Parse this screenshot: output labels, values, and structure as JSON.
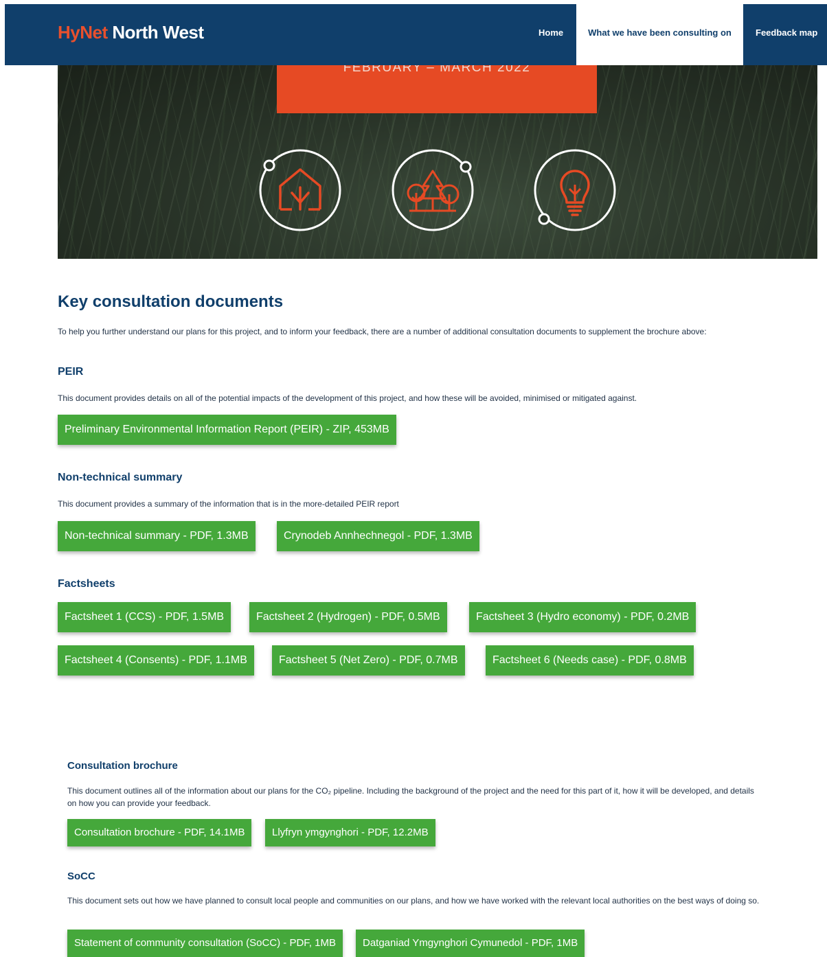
{
  "header": {
    "logo_hy": "HyNet",
    "logo_rest": " North West",
    "nav": {
      "home": "Home",
      "consulting": "What we have been consulting on",
      "feedback": "Feedback map"
    }
  },
  "hero": {
    "banner_text": "FEBRUARY – MARCH 2022",
    "icons": [
      "house-arrow-icon",
      "trees-icon",
      "lightbulb-icon"
    ]
  },
  "main": {
    "title": "Key consultation documents",
    "intro": "To help you further understand our plans for this project, and to inform your feedback, there are a number of additional consultation documents to supplement the brochure above:",
    "peir": {
      "heading": "PEIR",
      "desc": "This document provides details on all of the potential impacts of the development of this project, and how these will be avoided, minimised or mitigated against.",
      "buttons": [
        "Preliminary Environmental Information Report (PEIR) - ZIP, 453MB"
      ]
    },
    "nts": {
      "heading": "Non-technical summary",
      "desc": "This document provides a summary of the information that is in the more-detailed PEIR report",
      "buttons": [
        "Non-technical summary - PDF, 1.3MB",
        "Crynodeb Annhechnegol - PDF, 1.3MB"
      ]
    },
    "factsheets": {
      "heading": "Factsheets",
      "buttons": [
        "Factsheet 1 (CCS) - PDF, 1.5MB",
        "Factsheet 2 (Hydrogen) - PDF, 0.5MB",
        "Factsheet 3 (Hydro economy) - PDF, 0.2MB",
        "Factsheet 4 (Consents) - PDF, 1.1MB",
        "Factsheet 5 (Net Zero) - PDF, 0.7MB",
        "Factsheet 6 (Needs case) - PDF, 0.8MB"
      ]
    },
    "brochure": {
      "heading": "Consultation brochure",
      "desc": "This document outlines all of the information about our plans for the CO₂ pipeline. Including the background of the project and the need for this part of it, how it will be developed, and details on how you can provide your feedback.",
      "buttons": [
        "Consultation brochure - PDF, 14.1MB",
        "Llyfryn ymgynghori - PDF, 12.2MB"
      ]
    },
    "socc": {
      "heading": "SoCC",
      "desc": "This document sets out how we have planned to consult local people and communities on our plans, and how we have worked with the relevant local authorities on the best ways of doing so.",
      "buttons": [
        "Statement of community consultation (SoCC) - PDF, 1MB",
        "Datganiad Ymgynghori Cymunedol - PDF, 1MB"
      ]
    }
  },
  "colors": {
    "navy": "#103f6b",
    "orange": "#e64a24",
    "green": "#45a83b"
  }
}
